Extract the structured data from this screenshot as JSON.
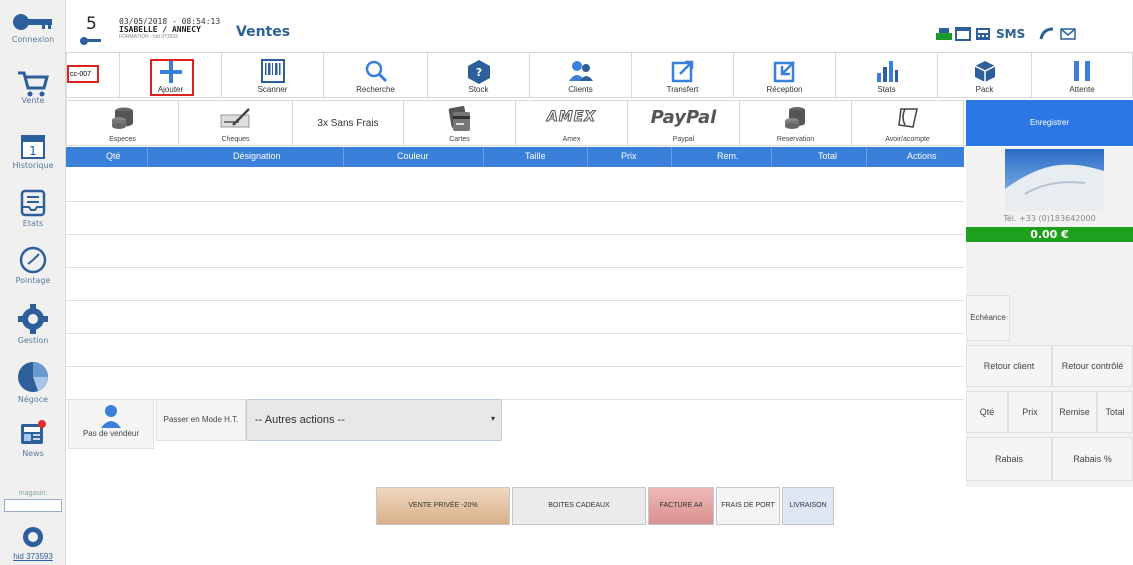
{
  "sidebar": {
    "items": [
      {
        "label": "Connexion",
        "icon": "key-icon"
      },
      {
        "label": "Vente",
        "icon": "cart-icon"
      },
      {
        "label": "Historique",
        "icon": "calendar-icon"
      },
      {
        "label": "Etats",
        "icon": "tray-icon"
      },
      {
        "label": "Pointage",
        "icon": "clock-icon"
      },
      {
        "label": "Gestion",
        "icon": "gear-icon"
      },
      {
        "label": "Négoce",
        "icon": "pie-icon"
      },
      {
        "label": "News",
        "icon": "news-icon"
      }
    ],
    "magasin_label": "magasin:",
    "magasin_value": "",
    "bottom_label": "hid 373593"
  },
  "header": {
    "number": "5",
    "datetime": "03/05/2018 - 08:54:13",
    "user": "ISABELLE / ANNECY",
    "sub": "FORMATION - hid 373593",
    "title": "Ventes",
    "sms": "SMS"
  },
  "toolbar": {
    "code_value": "cc-007",
    "buttons": [
      "Ajouter",
      "Scanner",
      "Recherche",
      "Stock",
      "Clients",
      "Transfert",
      "Réception",
      "Stats",
      "Pack",
      "Attente"
    ]
  },
  "payments": {
    "buttons": [
      "Especes",
      "Cheques",
      "3x Sans Frais",
      "Cartes",
      "Amex",
      "Paypal",
      "Reservation",
      "Avoir/acompte"
    ],
    "amex_logo": "AMEX",
    "paypal_logo": "PayPal",
    "save_label": "Enregistrer"
  },
  "table": {
    "headers": [
      "Qté",
      "Désignation",
      "Couleur",
      "Taille",
      "Prix",
      "Rem.",
      "Total",
      "Actions"
    ]
  },
  "right_panel": {
    "phone": "Tél. +33 (0)183642000",
    "total": "0.00 €",
    "echeance": "Echéance",
    "retour_client": "Retour client",
    "retour_controle": "Retour contrôlé",
    "qte": "Qté",
    "prix": "Prix",
    "remise": "Remise",
    "total_btn": "Total",
    "rabais": "Rabais",
    "rabais_pct": "Rabais %"
  },
  "actions": {
    "vendeur": "Pas de vendeur",
    "mode_ht": "Passer en Mode H.T.",
    "autres": "-- Autres actions --"
  },
  "bottom_buttons": [
    {
      "label": "VENTE PRIVÉE -20%",
      "color": "#e8c8a8"
    },
    {
      "label": "BOITES CADEAUX",
      "color": "#e8e8e8"
    },
    {
      "label": "FACTURE A4",
      "color": "#e8a8a8"
    },
    {
      "label": "FRAIS DE PORT",
      "color": "#f0f0f0"
    },
    {
      "label": "LIVRAISON",
      "color": "#d8e0f0"
    }
  ],
  "colors": {
    "accent": "#3a7fd9",
    "save": "#2b78e4",
    "total_bg": "#1ea01e",
    "icon": "#4a86c8"
  }
}
